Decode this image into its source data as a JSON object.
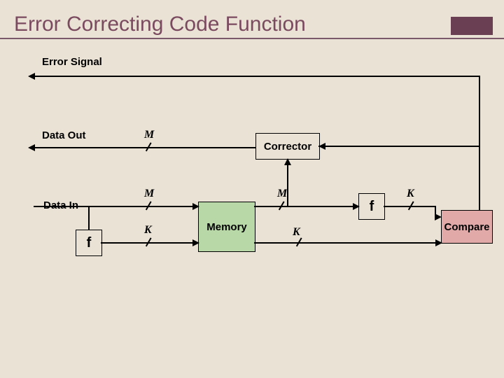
{
  "title": "Error Correcting Code Function",
  "labels": {
    "error_signal": "Error Signal",
    "data_out": "Data Out",
    "data_in": "Data In"
  },
  "blocks": {
    "corrector": "Corrector",
    "memory": "Memory",
    "compare": "Compare",
    "f1": "f",
    "f2": "f"
  },
  "bus": {
    "m": "M",
    "k": "K"
  }
}
